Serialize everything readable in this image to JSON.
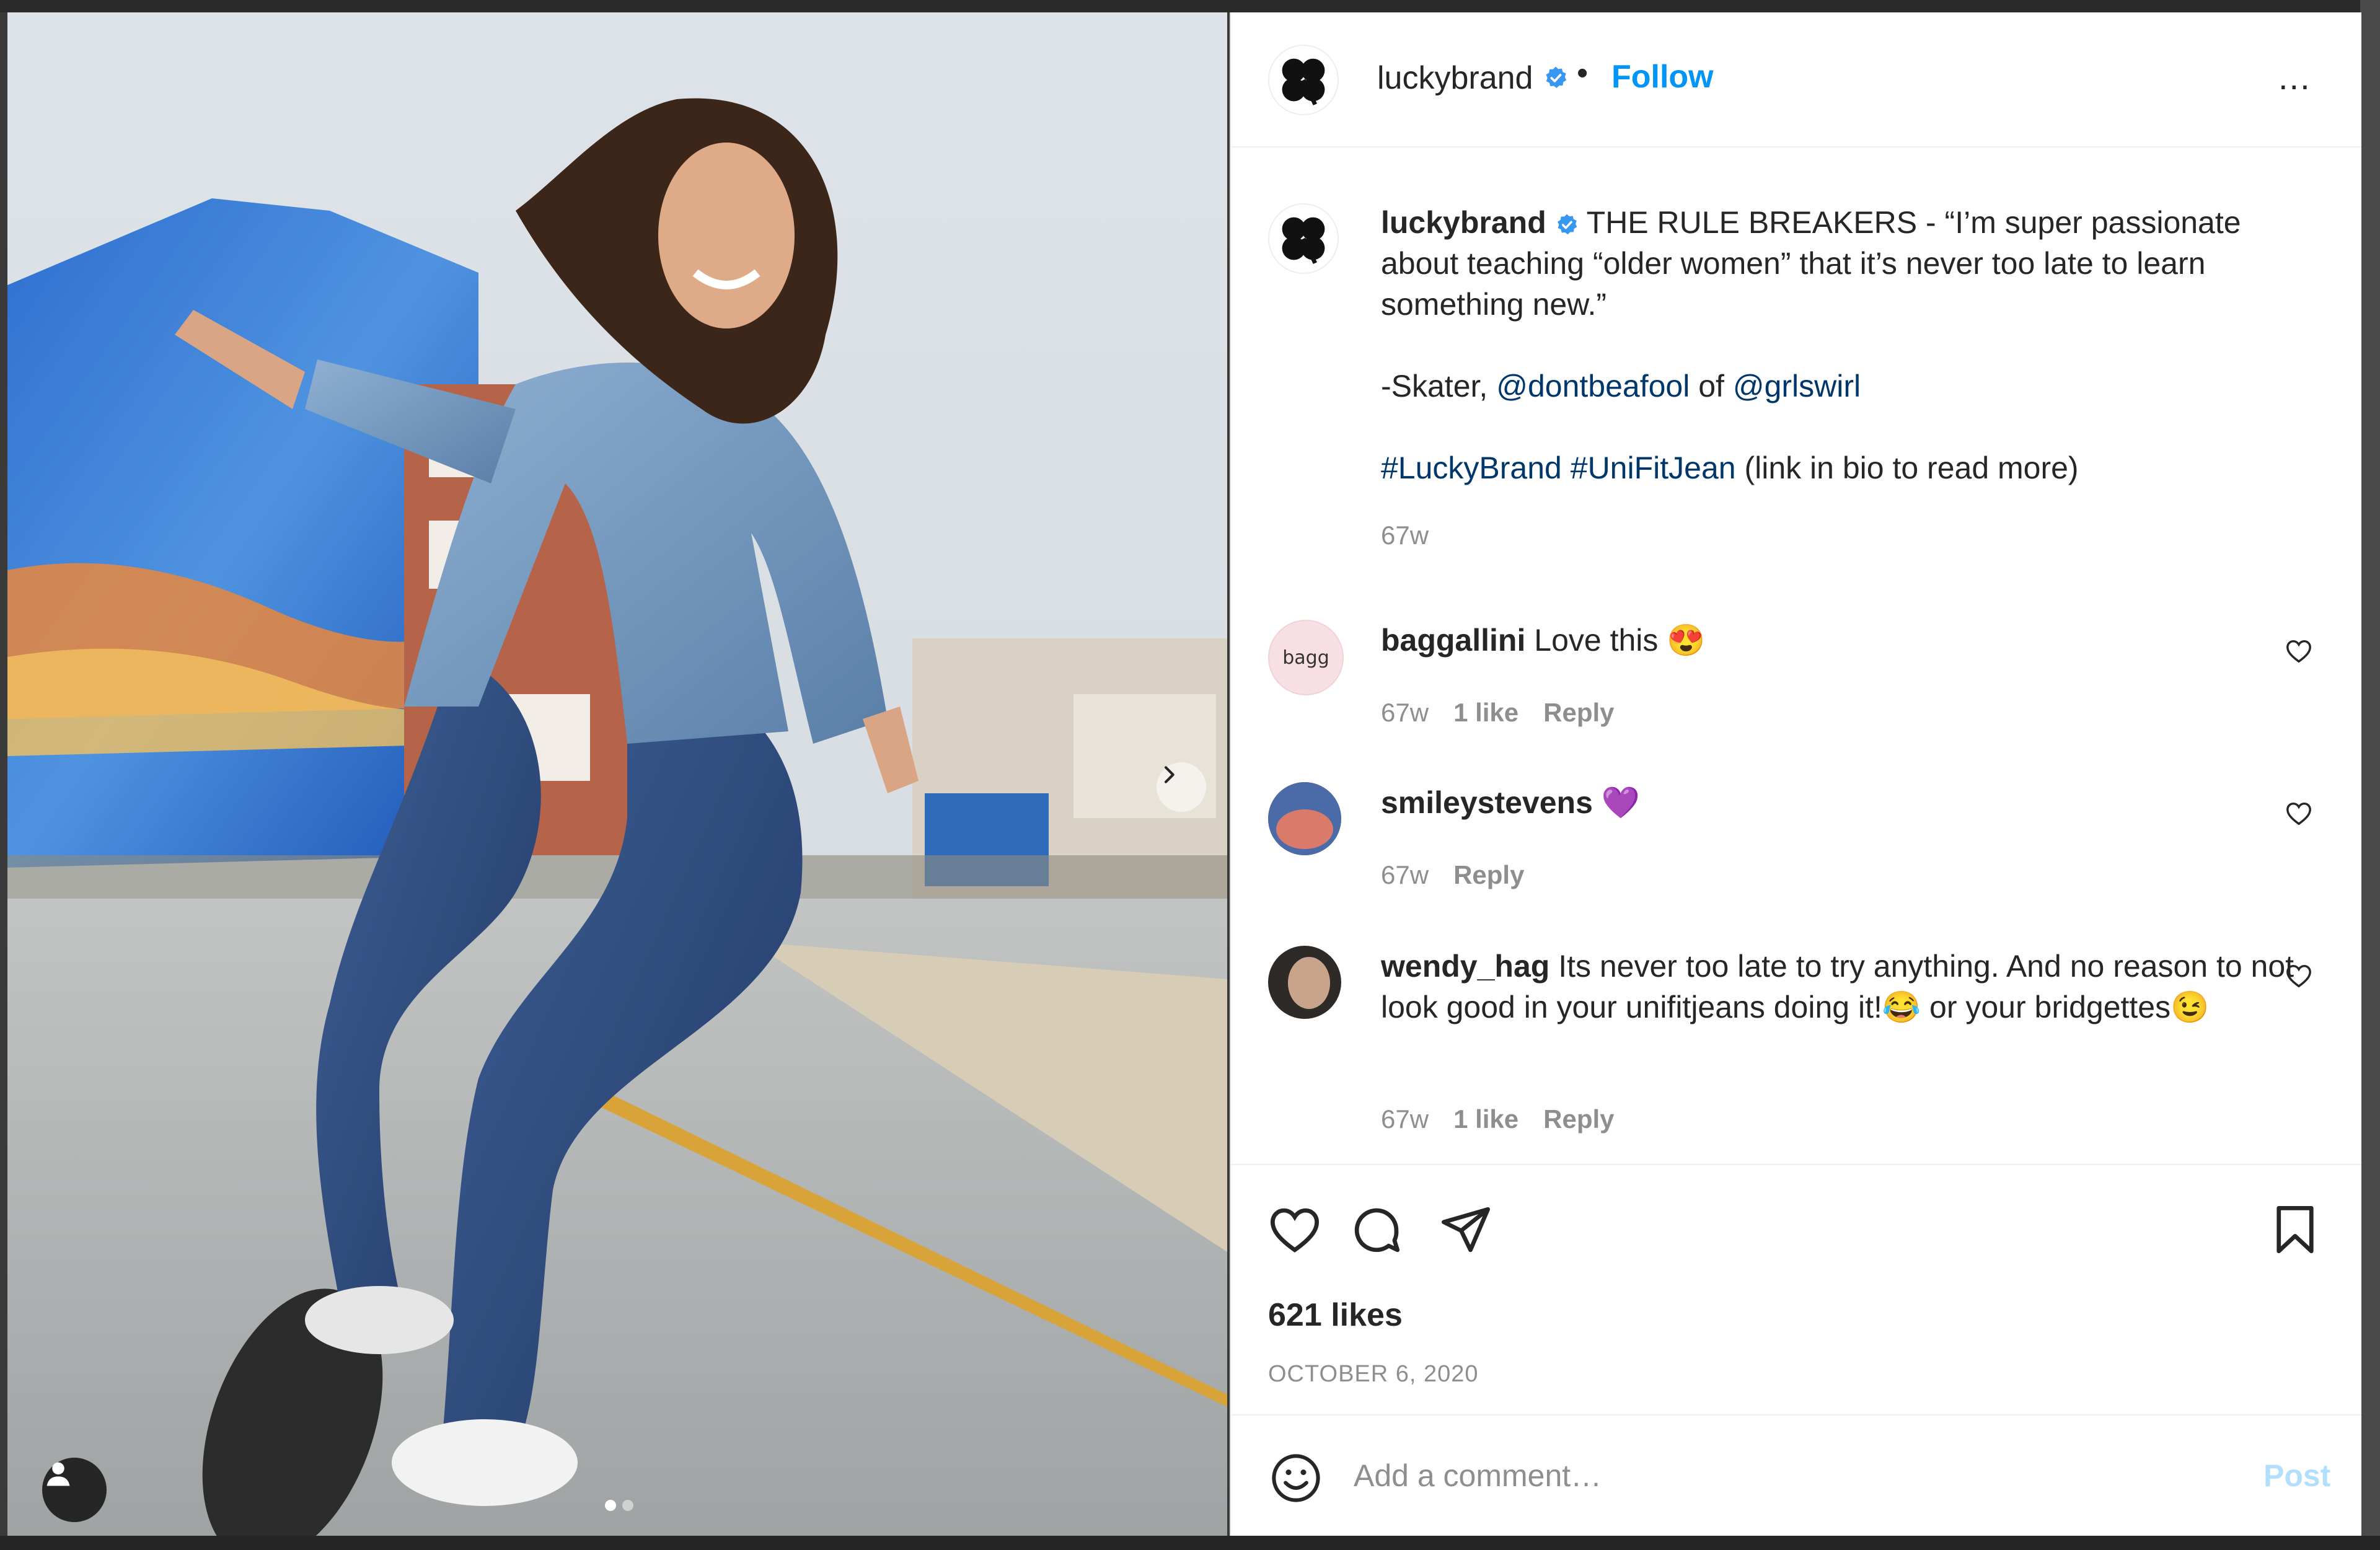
{
  "post": {
    "username": "luckybrand",
    "follow_label": "Follow",
    "separator": "•",
    "more_label": "...",
    "media": {
      "current_slide": 1,
      "slide_count": 2
    }
  },
  "caption": {
    "username": "luckybrand",
    "line1": "THE RULE BREAKERS - “I’m super passionate about teaching “older women” that it’s never too late to learn something new.”",
    "skater_prefix": "-Skater,",
    "mention1": "@dontbeafool",
    "of_word": "of",
    "mention2": "@grlswirl",
    "hashtag1": "#LuckyBrand",
    "hashtag2": "#UniFitJean",
    "link_note": "(link in bio to read more)",
    "time": "67w"
  },
  "comments": [
    {
      "username": "baggallini",
      "text": "Love this 😍",
      "avatar_text": "bagg",
      "time": "67w",
      "likes": "1 like",
      "reply": "Reply"
    },
    {
      "username": "smileystevens",
      "text": "💜",
      "time": "67w",
      "reply": "Reply"
    },
    {
      "username": "wendy_hag",
      "text": "Its never too late to try anything. And no reason to not look good in your unifitjeans doing it!😂 or your bridgettes😉",
      "time": "67w",
      "likes": "1 like",
      "reply": "Reply"
    }
  ],
  "stats": {
    "likes": "621 likes",
    "date": "OCTOBER 6, 2020"
  },
  "composer": {
    "placeholder": "Add a comment…",
    "post_label": "Post"
  },
  "colors": {
    "accent": "#0095f6",
    "link": "#00376b",
    "muted": "#8e8e8e",
    "post_disabled": "#b2dffc",
    "verified": "#3897f0"
  },
  "icons": {
    "like": "heart-icon",
    "comment": "comment-icon",
    "share": "send-icon",
    "save": "bookmark-icon",
    "emoji": "emoji-icon",
    "more": "more-options-icon",
    "next": "chevron-right-icon",
    "user_tag": "user-tag-icon"
  }
}
